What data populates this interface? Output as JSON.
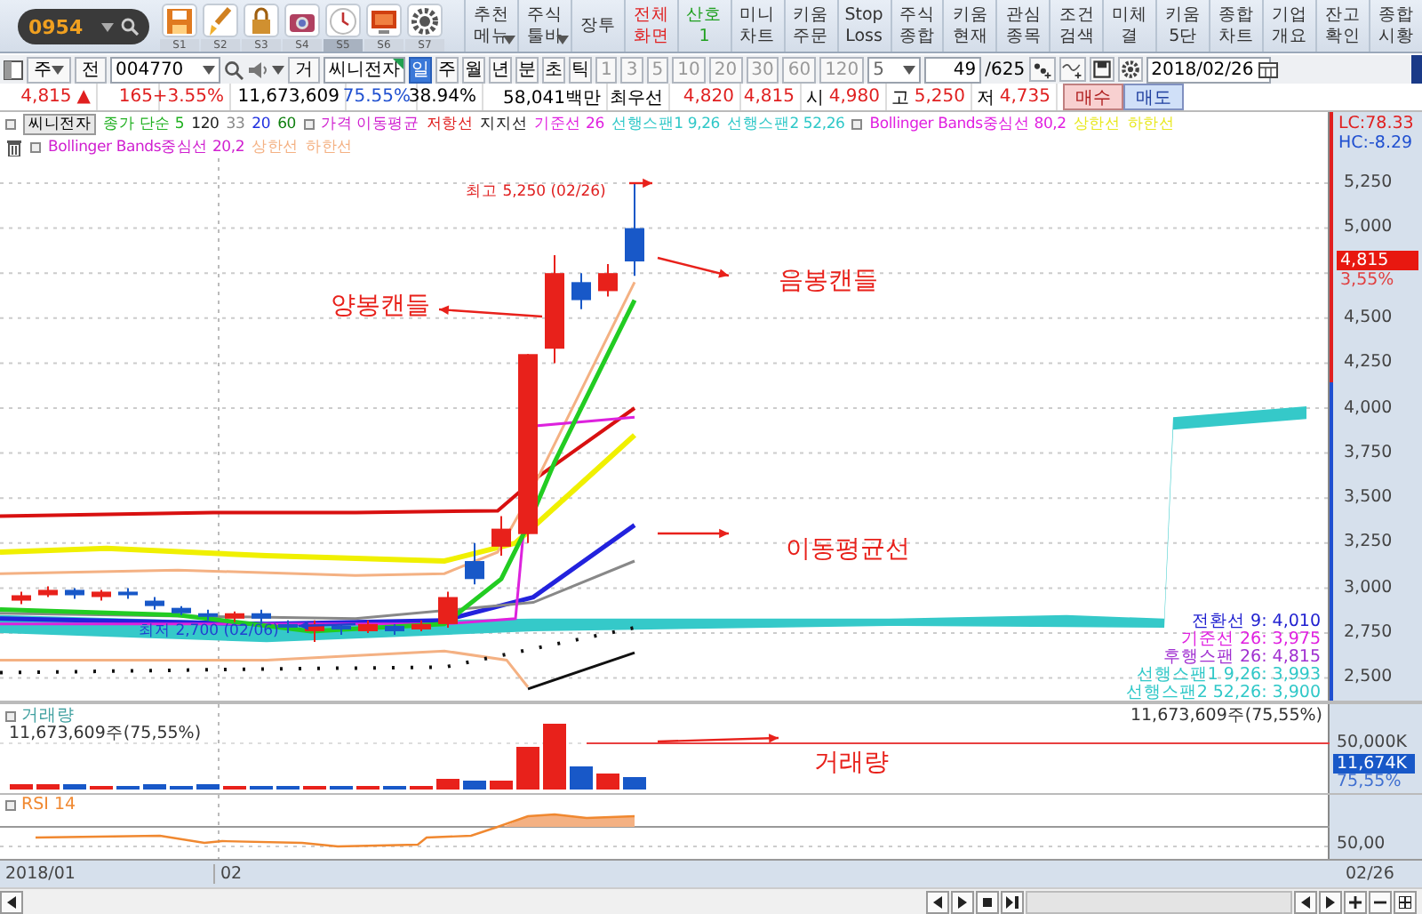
{
  "toolbar": {
    "code": "0954",
    "shortcuts": [
      {
        "label": "S1",
        "selected": false
      },
      {
        "label": "S2",
        "selected": false
      },
      {
        "label": "S3",
        "selected": false
      },
      {
        "label": "S4",
        "selected": false
      },
      {
        "label": "S5",
        "selected": true
      },
      {
        "label": "S6",
        "selected": false
      },
      {
        "label": "S7",
        "selected": false
      }
    ],
    "menu": [
      {
        "lines": [
          "추천",
          "메뉴"
        ],
        "color": "#333333",
        "dropdown": true
      },
      {
        "lines": [
          "주식",
          "툴바"
        ],
        "color": "#333333",
        "dropdown": true
      },
      {
        "lines": [
          "장투"
        ],
        "color": "#333333",
        "dropdown": false
      },
      {
        "lines": [
          "전체",
          "화면"
        ],
        "color": "#e02020",
        "dropdown": false
      },
      {
        "lines": [
          "산호",
          "1"
        ],
        "color": "#20a020",
        "dropdown": false
      },
      {
        "lines": [
          "미니",
          "차트"
        ],
        "color": "#333333",
        "dropdown": false
      },
      {
        "lines": [
          "키움",
          "주문"
        ],
        "color": "#333333",
        "dropdown": false
      },
      {
        "lines": [
          "Stop",
          "Loss"
        ],
        "color": "#333333",
        "dropdown": false
      },
      {
        "lines": [
          "주식",
          "종합"
        ],
        "color": "#333333",
        "dropdown": false
      },
      {
        "lines": [
          "키움",
          "현재"
        ],
        "color": "#333333",
        "dropdown": false
      },
      {
        "lines": [
          "관심",
          "종목"
        ],
        "color": "#333333",
        "dropdown": false
      },
      {
        "lines": [
          "조건",
          "검색"
        ],
        "color": "#333333",
        "dropdown": false
      },
      {
        "lines": [
          "미체",
          "결"
        ],
        "color": "#333333",
        "dropdown": false
      },
      {
        "lines": [
          "키움",
          "5단"
        ],
        "color": "#333333",
        "dropdown": false
      },
      {
        "lines": [
          "종합",
          "차트"
        ],
        "color": "#333333",
        "dropdown": false
      },
      {
        "lines": [
          "기업",
          "개요"
        ],
        "color": "#333333",
        "dropdown": false
      },
      {
        "lines": [
          "잔고",
          "확인"
        ],
        "color": "#333333",
        "dropdown": false
      },
      {
        "lines": [
          "종합",
          "시황"
        ],
        "color": "#333333",
        "dropdown": false
      }
    ]
  },
  "controls": {
    "market": "주",
    "mode": "전",
    "code": "004770",
    "name_label": "거",
    "name": "씨니전자",
    "periods": [
      {
        "label": "일",
        "selected": true
      },
      {
        "label": "주",
        "selected": false
      },
      {
        "label": "월",
        "selected": false
      },
      {
        "label": "년",
        "selected": false
      },
      {
        "label": "분",
        "selected": false
      },
      {
        "label": "초",
        "selected": false
      },
      {
        "label": "틱",
        "selected": false
      }
    ],
    "intervals": [
      {
        "label": "1",
        "disabled": true
      },
      {
        "label": "3",
        "disabled": true
      },
      {
        "label": "5",
        "disabled": true
      },
      {
        "label": "10",
        "disabled": true
      },
      {
        "label": "20",
        "disabled": true
      },
      {
        "label": "30",
        "disabled": true
      },
      {
        "label": "60",
        "disabled": true
      },
      {
        "label": "120",
        "disabled": true
      }
    ],
    "step": "5",
    "count": "49",
    "total": "/625",
    "date": "2018/02/26"
  },
  "quote": {
    "price": "4,815",
    "arrow": "▲",
    "change": "165",
    "rate": "+3.55%",
    "volume": "11,673,609",
    "turnover": "75.55%",
    "ratio": "38.94%",
    "amount": "58,041백만",
    "best_label": "최우선",
    "best_ask": "4,820",
    "best_bid": "4,815",
    "open_label": "시",
    "open": "4,980",
    "high_label": "고",
    "high": "5,250",
    "low_label": "저",
    "low": "4,735",
    "buy": "매수",
    "sell": "매도"
  },
  "price_chart": {
    "stock": "씨니전자",
    "legend": [
      {
        "text": "종가 단순 5",
        "color": "#20b020",
        "marker": false
      },
      {
        "text": "120",
        "color": "#222222",
        "marker": false
      },
      {
        "text": "33",
        "color": "#888888",
        "marker": false
      },
      {
        "text": "20",
        "color": "#2030e0",
        "marker": false
      },
      {
        "text": "60",
        "color": "#108010",
        "marker": false
      },
      {
        "text": "가격 이동평균",
        "color": "#d020d0",
        "marker": true
      },
      {
        "text": "저항선",
        "color": "#e02020",
        "marker": false
      },
      {
        "text": "지지선",
        "color": "#222222",
        "marker": false
      },
      {
        "text": "기준선 26",
        "color": "#e020e0",
        "marker": false
      },
      {
        "text": "선행스팬1 9,26",
        "color": "#30c8c8",
        "marker": false
      },
      {
        "text": "선행스팬2 52,26",
        "color": "#30c8c8",
        "marker": false
      },
      {
        "text": "Bollinger Bands중심선 80,2",
        "color": "#e020e0",
        "marker": true
      },
      {
        "text": "상한선",
        "color": "#e8e820",
        "marker": false
      },
      {
        "text": "하한선",
        "color": "#e8e820",
        "marker": false
      }
    ],
    "legend_row2": [
      {
        "text": "Bollinger Bands중심선 20,2",
        "color": "#d020d0",
        "marker": true
      },
      {
        "text": "상한선",
        "color": "#f4b183",
        "marker": false
      },
      {
        "text": "하한선",
        "color": "#f4b183",
        "marker": false
      }
    ],
    "lc": "LC:78.33",
    "hc": "HC:-8.29",
    "yticks": [
      "5,250",
      "5,000",
      "4,500",
      "4,250",
      "4,000",
      "3,750",
      "3,500",
      "3,250",
      "3,000",
      "2,750",
      "2,500"
    ],
    "current_price": "4,815",
    "current_rate": "3,55%",
    "high_note": "최고 5,250 (02/26)",
    "low_note": "최저 2,700 (02/06)",
    "callouts": [
      "음봉캔들",
      "양봉캔들",
      "이동평균선"
    ],
    "ichimoku": [
      {
        "text": "전환선 9: 4,010",
        "color": "#2020d0"
      },
      {
        "text": "기준선 26: 3,975",
        "color": "#e020e0"
      },
      {
        "text": "후행스팬 26: 4,815",
        "color": "#a030d0"
      },
      {
        "text": "선행스팬1 9,26: 3,993",
        "color": "#30c8c8"
      },
      {
        "text": "선행스팬2 52,26: 3,900",
        "color": "#30c8c8"
      }
    ]
  },
  "volume": {
    "title": "거래량",
    "total": "11,673,609주(75,55%)",
    "total_right": "11,673,609주(75,55%)",
    "callout": "거래량",
    "tick": "50,000K",
    "current": "11,674K",
    "rate": "75,55%"
  },
  "rsi": {
    "title": "RSI 14",
    "tick": "50,00"
  },
  "dates": {
    "start": "2018/01",
    "month": "02",
    "end": "02/26"
  }
}
